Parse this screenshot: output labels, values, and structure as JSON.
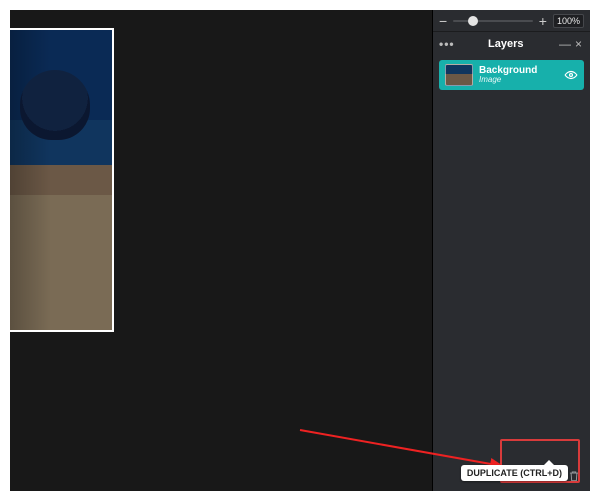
{
  "zoom": {
    "value_label": "100%"
  },
  "panel": {
    "title": "Layers"
  },
  "layers": [
    {
      "name": "Background",
      "kind": "Image"
    }
  ],
  "tooltip": {
    "duplicate": "DUPLICATE (CTRL+D)"
  }
}
